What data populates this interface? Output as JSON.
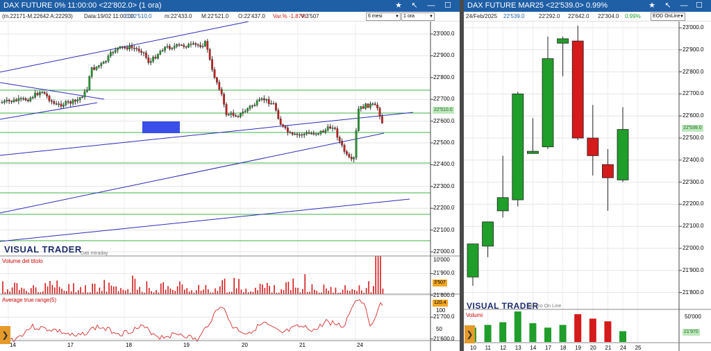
{
  "left": {
    "title": "DAX FUTURE 0%  11:00:00  <22'802.0>  (1 ora)",
    "info": {
      "range": "(m.22171-M.22642 A:22293)",
      "date": "Data:19/02 11:00:00",
      "close": "C:22'510.0",
      "min": "m:22'433.0",
      "max": "M:22'521.0",
      "open": "O:22'437.0",
      "var": "Var.% -1.87%",
      "vol": "V:3'507"
    },
    "period_select": "6 mesi",
    "interval_select": "1 ora",
    "price_ticks": [
      "23'000.0",
      "22'900.0",
      "22'800.0",
      "22'700.0",
      "22'600.0",
      "22'500.0",
      "22'400.0",
      "22'300.0",
      "22'200.0",
      "22'100.0",
      "22'000.0",
      "21'900.0",
      "21'800.0",
      "21'700.0",
      "21'600.0"
    ],
    "last_price_tag": "22'510.0",
    "logo": "VISUAL TRADER",
    "logo_sub": "Dati Intraday",
    "volume_title": "Volume del titolo",
    "volume_tick": "10'000",
    "volume_tag": "3'507",
    "atr_title": "Average true range(5)",
    "atr_ticks": [
      "100",
      "50"
    ],
    "atr_tag": "120.4",
    "x_labels": [
      "14",
      "17",
      "18",
      "19",
      "20",
      "21",
      "24"
    ]
  },
  "right": {
    "title": "DAX FUTURE MAR25  <22'539.0>  0.99%",
    "info": {
      "date": "24/Feb/2025",
      "close": "22'539.0",
      "o": "22'292.0",
      "h": "22'642.0",
      "l": "22'304.0",
      "pct": "0.99%"
    },
    "source_select": "EOD OnLine",
    "price_ticks": [
      "23'000.0",
      "22'900.0",
      "22'800.0",
      "22'700.0",
      "22'600.0",
      "22'500.0",
      "22'400.0",
      "22'300.0",
      "22'200.0",
      "22'100.0",
      "22'000.0",
      "21'900.0",
      "21'800.0"
    ],
    "last_price_tag": "22'539.0",
    "logo": "VISUAL TRADER",
    "logo_sub": "Storico On Line",
    "volume_title": "Volumi",
    "volume_tick": "50'000",
    "volume_tag": "21'970",
    "x_labels": [
      "10",
      "11",
      "12",
      "13",
      "14",
      "17",
      "18",
      "19",
      "20",
      "21",
      "24",
      "25"
    ]
  },
  "colors": {
    "up": "#1f9e2a",
    "down": "#d41a1a",
    "title_bar": "#1f5fa6",
    "trend": "#2b2bb8",
    "level": "#3cb043"
  },
  "chart_data": [
    {
      "type": "candlestick",
      "title": "DAX FUTURE MAR25",
      "xlabel": "",
      "ylabel": "",
      "categories": [
        "10",
        "11",
        "12",
        "13",
        "14",
        "17",
        "18",
        "19",
        "20",
        "21",
        "24"
      ],
      "open": [
        21870,
        22010,
        22170,
        22220,
        22430,
        22460,
        22930,
        22940,
        22500,
        22380,
        22310
      ],
      "high": [
        22010,
        22100,
        22420,
        22710,
        22590,
        22960,
        22960,
        23010,
        22650,
        22450,
        22640
      ],
      "low": [
        21830,
        21960,
        22140,
        22190,
        22430,
        22450,
        22780,
        22490,
        22330,
        22170,
        22300
      ],
      "close": [
        22020,
        22120,
        22230,
        22700,
        22440,
        22860,
        22950,
        22500,
        22420,
        22320,
        22539
      ],
      "volume": [
        16,
        19,
        22,
        34,
        21,
        16,
        19,
        31,
        26,
        23,
        12
      ],
      "ylim": [
        21750,
        23050
      ]
    },
    {
      "type": "line",
      "title": "Average true range(5)",
      "xlabel": "",
      "ylabel": "",
      "ylim": [
        0,
        130
      ]
    }
  ]
}
